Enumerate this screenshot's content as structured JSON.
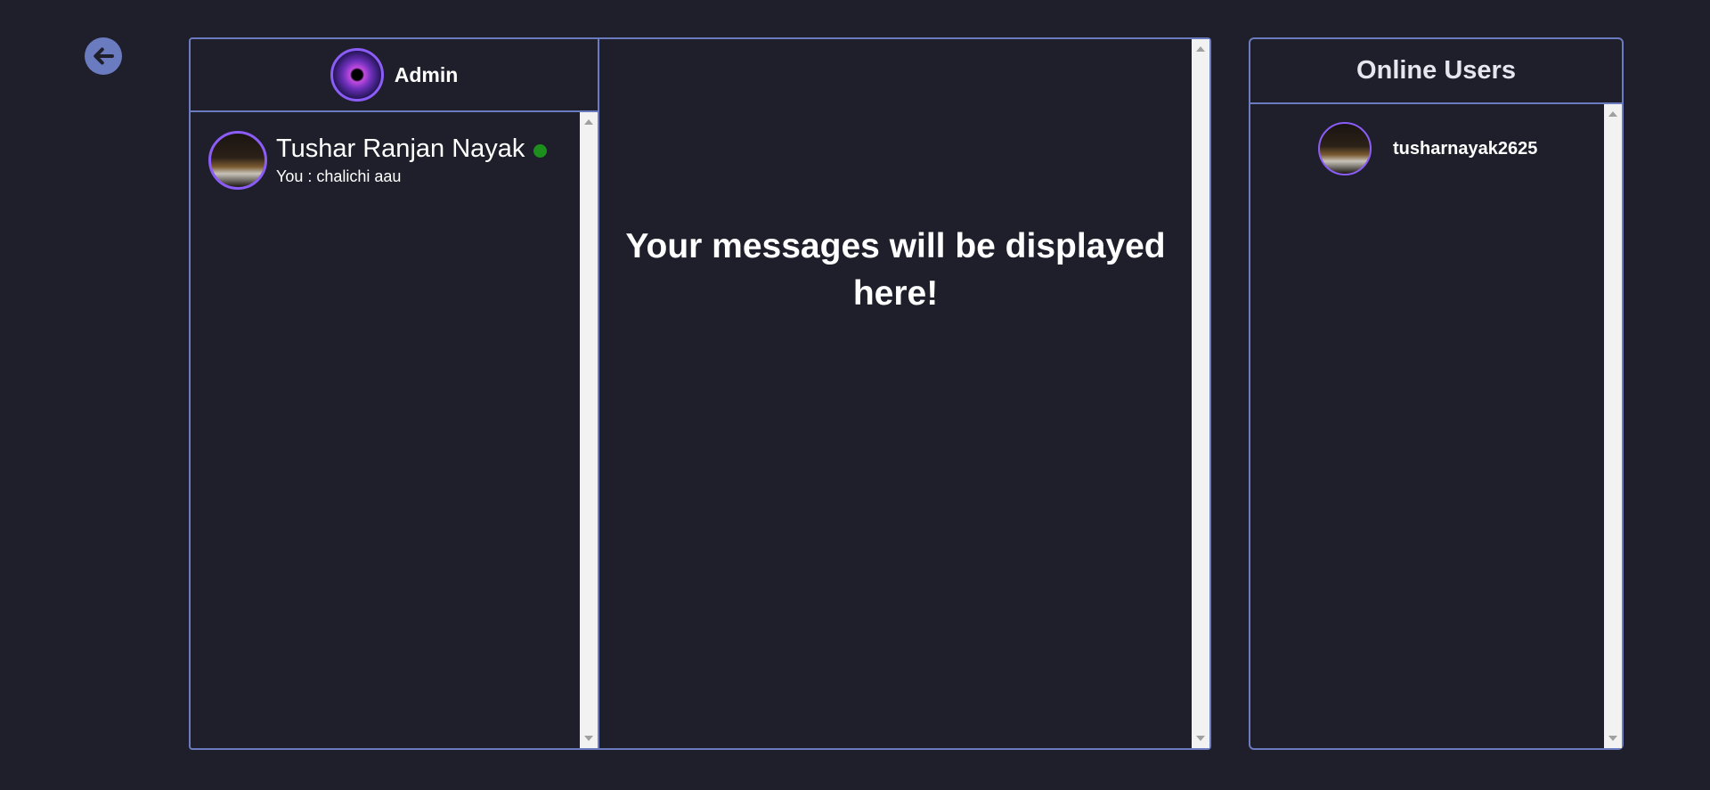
{
  "nav": {
    "back_icon": "arrow-left-icon"
  },
  "chat": {
    "header": {
      "name": "Admin",
      "avatar_icon": "admin-avatar"
    },
    "conversations": [
      {
        "name": "Tushar Ranjan Nayak",
        "last_message": "You : chalichi aau",
        "online": true,
        "online_color": "#1c8f1c"
      }
    ],
    "placeholder": "Your messages will be displayed here!"
  },
  "online_users": {
    "title": "Online Users",
    "users": [
      {
        "username": "tusharnayak2625"
      }
    ]
  },
  "colors": {
    "background": "#1f1e2b",
    "border": "#6b7bbf",
    "avatar_ring": "#8b5cf6"
  }
}
